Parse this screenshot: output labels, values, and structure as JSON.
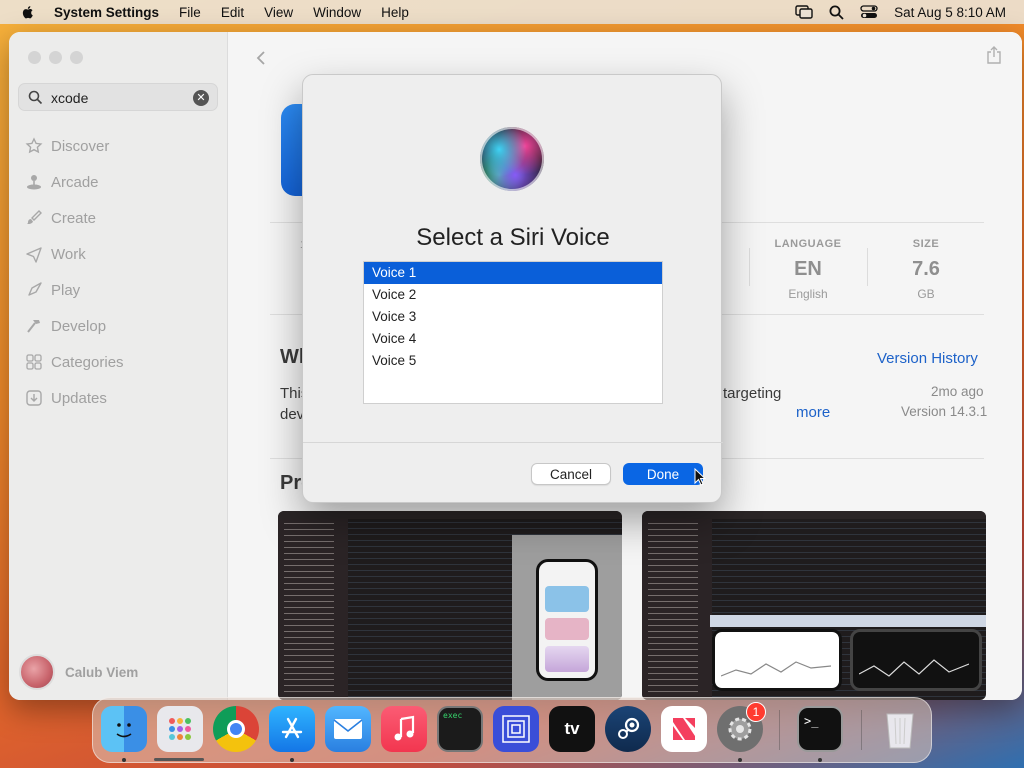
{
  "menubar": {
    "apple_icon": "apple-logo",
    "app_name": "System Settings",
    "menus": [
      "File",
      "Edit",
      "View",
      "Window",
      "Help"
    ],
    "clock": "Sat Aug 5  8:10 AM"
  },
  "sidebar": {
    "search": {
      "value": "xcode",
      "placeholder": "Search"
    },
    "items": [
      {
        "label": "Discover",
        "icon": "star-icon"
      },
      {
        "label": "Arcade",
        "icon": "joystick-icon"
      },
      {
        "label": "Create",
        "icon": "brush-icon"
      },
      {
        "label": "Work",
        "icon": "paper-plane-icon"
      },
      {
        "label": "Play",
        "icon": "rocket-icon"
      },
      {
        "label": "Develop",
        "icon": "hammer-icon"
      },
      {
        "label": "Categories",
        "icon": "grid-icon"
      },
      {
        "label": "Updates",
        "icon": "download-icon"
      }
    ],
    "user_name": "Calub Viem"
  },
  "main": {
    "ratings_partial": "12",
    "star_partial": "★",
    "stats": {
      "language": {
        "caption": "LANGUAGE",
        "value": "EN",
        "sub": "English"
      },
      "size": {
        "caption": "SIZE",
        "value": "7.6",
        "sub": "GB"
      }
    },
    "whats_new": {
      "heading_partial": "Wh",
      "version_history": "Version History",
      "body_left": "This",
      "body_left2": "devi",
      "body_right": "targeting",
      "more": "more",
      "time_ago": "2mo ago",
      "version": "Version 14.3.1"
    },
    "preview_heading_partial": "Pre"
  },
  "modal": {
    "title": "Select a Siri Voice",
    "voices": [
      "Voice 1",
      "Voice 2",
      "Voice 3",
      "Voice 4",
      "Voice 5"
    ],
    "selected_index": 0,
    "cancel_label": "Cancel",
    "done_label": "Done"
  },
  "dock": {
    "apps": [
      "Finder",
      "Launchpad",
      "Chrome",
      "App Store",
      "Mail",
      "Music",
      "Terminal",
      "Screens",
      "Apple TV",
      "Steam",
      "News",
      "System Settings",
      "Terminal",
      "Trash"
    ],
    "system_settings_badge": "1",
    "tv_label": "tv"
  }
}
